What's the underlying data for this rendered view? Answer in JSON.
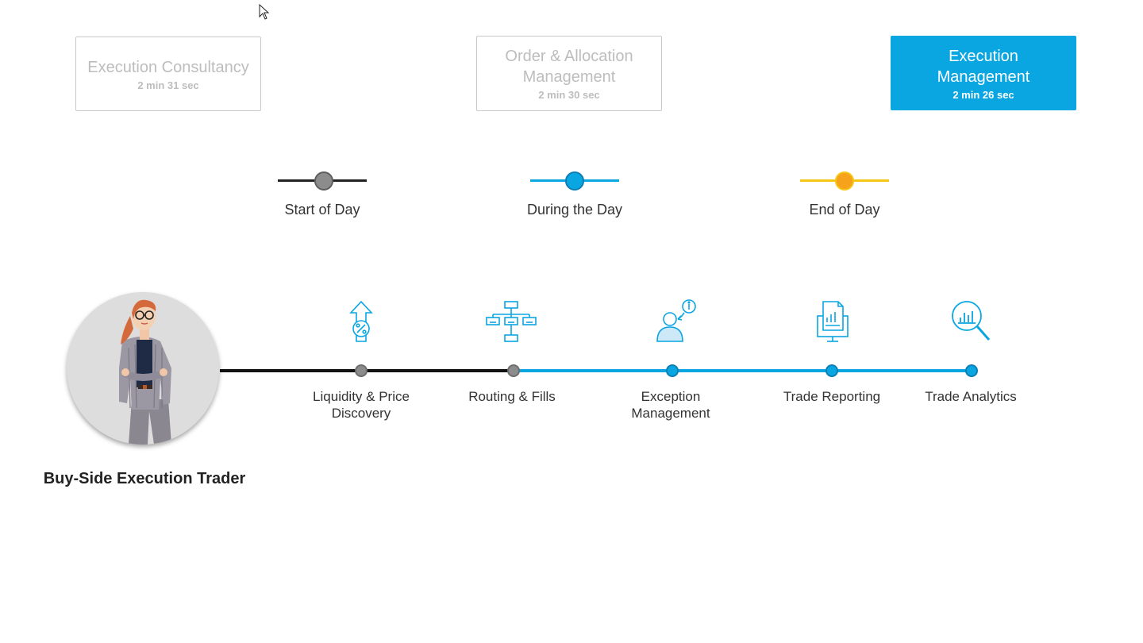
{
  "cards": [
    {
      "title": "Execution Consultancy",
      "duration": "2 min 31 sec",
      "active": false
    },
    {
      "title": "Order & Allocation Management",
      "duration": "2 min 30 sec",
      "active": false
    },
    {
      "title": "Execution Management",
      "duration": "2  min 26 sec",
      "active": true
    }
  ],
  "legend": [
    {
      "label": "Start of Day",
      "color": "#222222",
      "dot_color": "#8c8c8c"
    },
    {
      "label": "During the Day",
      "color": "#0aa6e2",
      "dot_color": "#0aa6e2"
    },
    {
      "label": "End of Day",
      "color": "#f5c518",
      "dot_color": "#f7a21b"
    }
  ],
  "persona": {
    "title": "Buy-Side Execution Trader"
  },
  "steps": [
    {
      "label": "Liquidity & Price Discovery",
      "icon": "percent-arrow-icon",
      "phase": "start"
    },
    {
      "label": "Routing & Fills",
      "icon": "routing-flowchart-icon",
      "phase": "start"
    },
    {
      "label": "Exception Management",
      "icon": "user-alert-icon",
      "phase": "during"
    },
    {
      "label": "Trade Reporting",
      "icon": "report-monitor-icon",
      "phase": "during"
    },
    {
      "label": "Trade Analytics",
      "icon": "analytics-magnifier-icon",
      "phase": "during"
    }
  ],
  "colors": {
    "accent": "#0aa6e2",
    "start": "#222222",
    "end": "#f5c518"
  }
}
